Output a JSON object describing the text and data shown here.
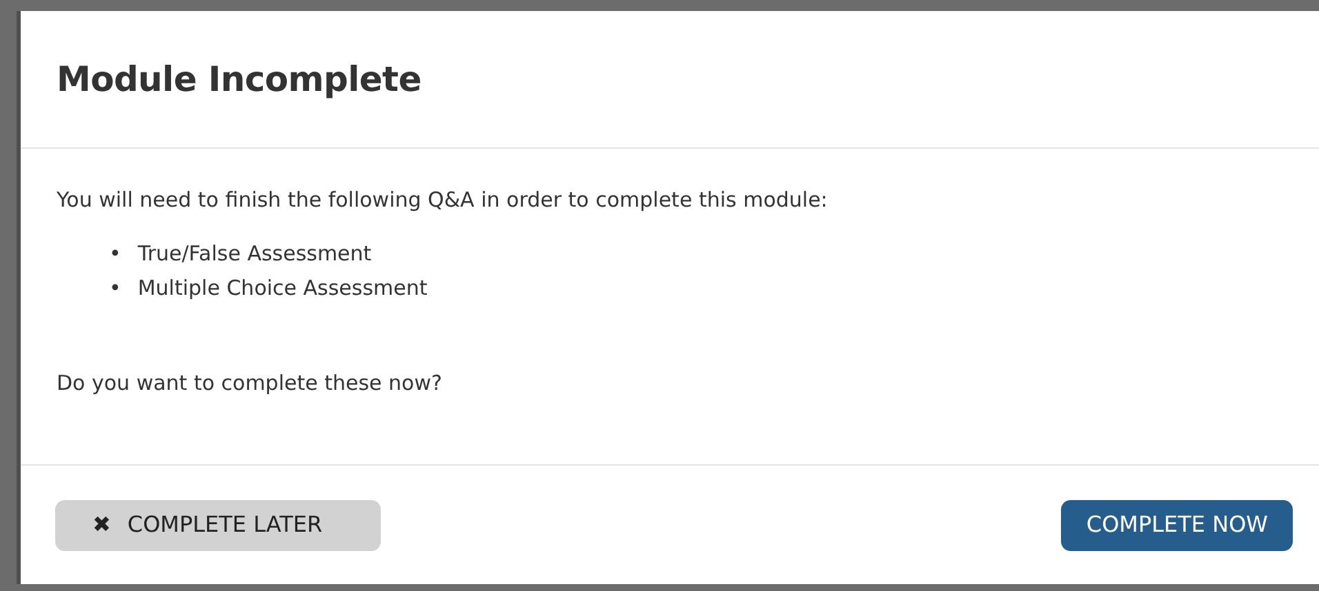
{
  "dialog": {
    "title": "Module Incomplete",
    "message": "You will need to finish the following Q&A in order to complete this module:",
    "items": [
      {
        "bullet": "•",
        "text": "True/False Assessment"
      },
      {
        "bullet": "•",
        "text": "Multiple Choice Assessment"
      }
    ],
    "question": "Do you want to complete these now?",
    "buttons": [
      {
        "kind": "secondary",
        "icon": "✖",
        "label": "COMPLETE LATER"
      },
      {
        "kind": "primary",
        "label": "COMPLETE NOW"
      }
    ]
  }
}
